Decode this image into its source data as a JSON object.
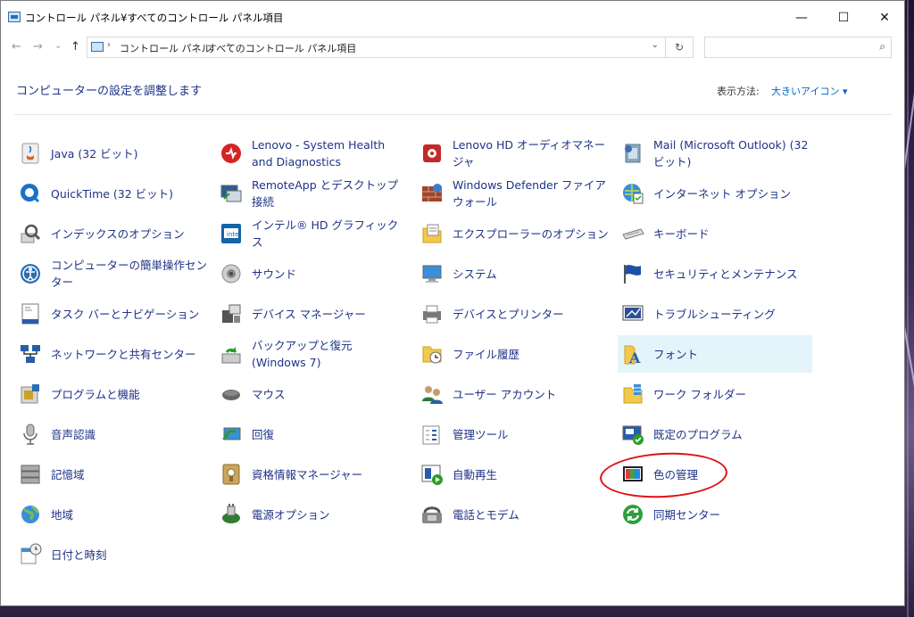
{
  "window": {
    "title": "コントロール パネル¥すべてのコントロール パネル項目",
    "minimize": "—",
    "maximize": "☐",
    "close": "✕"
  },
  "nav": {
    "back": "←",
    "forward": "→",
    "recent": "⌄",
    "up": "↑"
  },
  "address": {
    "crumbs": [
      "コントロール パネル",
      "すべてのコントロール パネル項目"
    ],
    "separator": "›",
    "dropdown": "⌄",
    "refresh": "↻"
  },
  "search": {
    "placeholder": "",
    "icon": "⌕"
  },
  "header": {
    "title": "コンピューターの設定を調整します",
    "view_label": "表示方法:",
    "view_value": "大きいアイコン ▾"
  },
  "items": [
    {
      "label": "Java (32 ビット)",
      "icon": "java-icon"
    },
    {
      "label": "Lenovo - System Health and Diagnostics",
      "icon": "lenovo-health-icon"
    },
    {
      "label": "Lenovo HD オーディオマネージャ",
      "icon": "audio-manager-icon"
    },
    {
      "label": "Mail (Microsoft Outlook) (32 ビット)",
      "icon": "mail-icon"
    },
    {
      "label": "QuickTime (32 ビット)",
      "icon": "quicktime-icon"
    },
    {
      "label": "RemoteApp とデスクトップ接続",
      "icon": "remoteapp-icon"
    },
    {
      "label": "Windows Defender ファイアウォール",
      "icon": "firewall-icon"
    },
    {
      "label": "インターネット オプション",
      "icon": "internet-options-icon"
    },
    {
      "label": "インデックスのオプション",
      "icon": "indexing-icon"
    },
    {
      "label": "インテル® HD グラフィックス",
      "icon": "intel-graphics-icon"
    },
    {
      "label": "エクスプローラーのオプション",
      "icon": "explorer-options-icon"
    },
    {
      "label": "キーボード",
      "icon": "keyboard-icon"
    },
    {
      "label": "コンピューターの簡単操作センター",
      "icon": "ease-of-access-icon"
    },
    {
      "label": "サウンド",
      "icon": "sound-icon"
    },
    {
      "label": "システム",
      "icon": "system-icon"
    },
    {
      "label": "セキュリティとメンテナンス",
      "icon": "security-flag-icon"
    },
    {
      "label": "タスク バーとナビゲーション",
      "icon": "taskbar-icon"
    },
    {
      "label": "デバイス マネージャー",
      "icon": "device-manager-icon"
    },
    {
      "label": "デバイスとプリンター",
      "icon": "printer-icon"
    },
    {
      "label": "トラブルシューティング",
      "icon": "troubleshoot-icon"
    },
    {
      "label": "ネットワークと共有センター",
      "icon": "network-icon"
    },
    {
      "label": "バックアップと復元 (Windows 7)",
      "icon": "backup-icon"
    },
    {
      "label": "ファイル履歴",
      "icon": "file-history-icon"
    },
    {
      "label": "フォント",
      "icon": "font-icon"
    },
    {
      "label": "プログラムと機能",
      "icon": "programs-icon"
    },
    {
      "label": "マウス",
      "icon": "mouse-icon"
    },
    {
      "label": "ユーザー アカウント",
      "icon": "user-accounts-icon"
    },
    {
      "label": "ワーク フォルダー",
      "icon": "work-folders-icon"
    },
    {
      "label": "音声認識",
      "icon": "microphone-icon"
    },
    {
      "label": "回復",
      "icon": "recovery-icon"
    },
    {
      "label": "管理ツール",
      "icon": "admin-tools-icon"
    },
    {
      "label": "既定のプログラム",
      "icon": "default-programs-icon"
    },
    {
      "label": "記憶域",
      "icon": "storage-icon"
    },
    {
      "label": "資格情報マネージャー",
      "icon": "credential-icon"
    },
    {
      "label": "自動再生",
      "icon": "autoplay-icon"
    },
    {
      "label": "色の管理",
      "icon": "color-management-icon"
    },
    {
      "label": "地域",
      "icon": "region-icon"
    },
    {
      "label": "電源オプション",
      "icon": "power-icon"
    },
    {
      "label": "電話とモデム",
      "icon": "phone-modem-icon"
    },
    {
      "label": "同期センター",
      "icon": "sync-center-icon"
    },
    {
      "label": "日付と時刻",
      "icon": "date-time-icon"
    }
  ],
  "colors": {
    "link": "#1e3287",
    "hover_bg": "#e5f3fb",
    "annotation": "#e20f15"
  }
}
